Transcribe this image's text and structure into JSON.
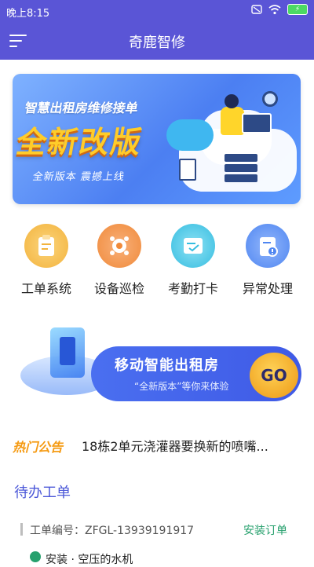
{
  "status": {
    "time": "晚上8:15",
    "battery": "⚡"
  },
  "header": {
    "title": "奇鹿智修"
  },
  "banner": {
    "line1": "智慧出租房维修接单",
    "line2": "全新改版",
    "line3": "全新版本  震撼上线"
  },
  "quick": [
    {
      "label": "工单系统",
      "icon": "clipboard-icon",
      "color": "#f3b33d"
    },
    {
      "label": "设备巡检",
      "icon": "device-icon",
      "color": "#f08a3a"
    },
    {
      "label": "考勤打卡",
      "icon": "checkin-icon",
      "color": "#35bde0"
    },
    {
      "label": "异常处理",
      "icon": "alert-icon",
      "color": "#4f86f1"
    }
  ],
  "promo": {
    "title": "移动智能出租房",
    "subtitle": "“全新版本”等你来体验",
    "go": "GO"
  },
  "notice": {
    "tag": "热门公告",
    "text": "18栋2单元浇灌器要换新的喷嘴..."
  },
  "todo": {
    "title": "待办工单",
    "order": {
      "number": "工单编号：ZFGL-13939191917",
      "type": "安装订单",
      "next": "安装 · 空压的水机"
    }
  }
}
